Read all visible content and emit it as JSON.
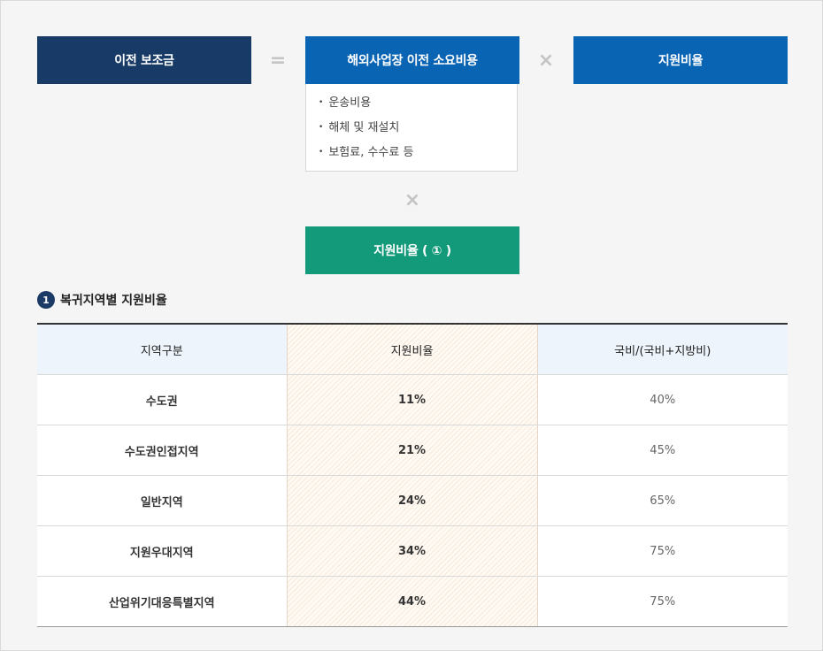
{
  "formula": {
    "result": "이전 보조금",
    "equals_symbol": "=",
    "cost_title": "해외사업장 이전 소요비용",
    "times_symbol": "×",
    "rate_title": "지원비율",
    "cost_items": [
      "운송비용",
      "해체 및 재설치",
      "보험료, 수수료 등"
    ],
    "times_symbol_2": "×",
    "rate_ref_title": "지원비율 ( ① )",
    "colors": {
      "navy": "#173a66",
      "blue": "#0a64b4",
      "green": "#139a7a"
    }
  },
  "section": {
    "number": "1",
    "title": "복귀지역별 지원비율"
  },
  "table": {
    "headers": [
      "지역구분",
      "지원비율",
      "국비/(국비+지방비)"
    ],
    "rows": [
      [
        "수도권",
        "11%",
        "40%"
      ],
      [
        "수도권인접지역",
        "21%",
        "45%"
      ],
      [
        "일반지역",
        "24%",
        "65%"
      ],
      [
        "지원우대지역",
        "34%",
        "75%"
      ],
      [
        "산업위기대응특별지역",
        "44%",
        "75%"
      ]
    ]
  }
}
